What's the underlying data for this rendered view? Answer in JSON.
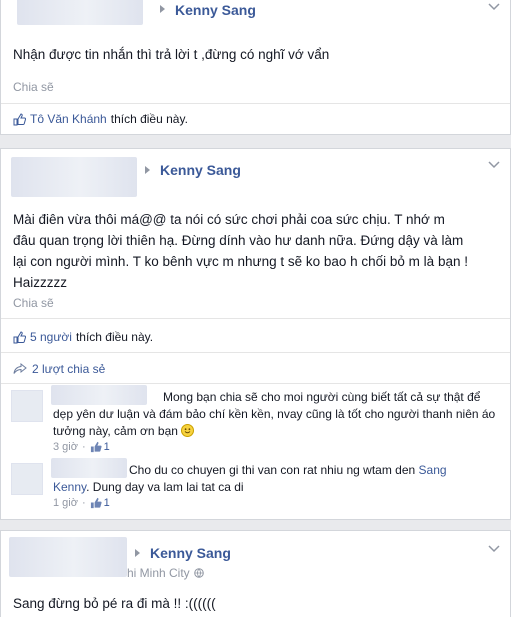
{
  "posts": [
    {
      "author": "Kenny Sang",
      "text": "Nhận được tin nhắn thì trả lời t ,đừng có nghĩ vớ vẩn",
      "share": "Chia sẽ",
      "likes": {
        "who": "Tô Văn Khánh",
        "suffix": "thích điều này."
      }
    },
    {
      "author": "Kenny Sang",
      "text_lines": [
        "Mài điên vừa thôi má@@ ta nói có sức chơi phải coa sức chịu. T nhớ m",
        "đâu quan trọng lời thiên hạ. Đừng dính vào hư danh nữa. Đứng dậy và làm",
        "lại con người mình. T ko bênh vực m nhưng t sẽ ko bao h chối bỏ m là bạn !",
        "Haizzzzz"
      ],
      "share": "Chia sẽ",
      "likes": {
        "who": "5 người",
        "suffix": "thích điều này."
      },
      "shares": "2 lượt chia sẻ",
      "comments": [
        {
          "lines": [
            "Mong bạn chia sẽ cho moi người cùng biết tất cả sự thật để",
            "dẹp yên dư luận và đám bảo chí kền kền, nvay cũng là tốt cho người thanh niên áo",
            "tưởng này, cảm ơn bạn"
          ],
          "time": "3 giờ",
          "like_count": "1"
        },
        {
          "line1": "Cho du co chuyen gi thi van con rat nhiu ng wtam den",
          "line1_link": "Sang",
          "line2_link": "Kenny",
          "line2_rest": ". Dung day va lam lai tat ca di",
          "time": "1 giờ",
          "like_count": "1"
        }
      ]
    },
    {
      "author": "Kenny Sang",
      "location": "hi Minh City",
      "text": "Sang đừng bỏ pé ra đi mà !! :((((((",
      "icons": {
        "globe": "globe-icon"
      }
    }
  ],
  "colors": {
    "link": "#3b5998",
    "muted": "#9197a3",
    "border": "#d3d6db"
  }
}
